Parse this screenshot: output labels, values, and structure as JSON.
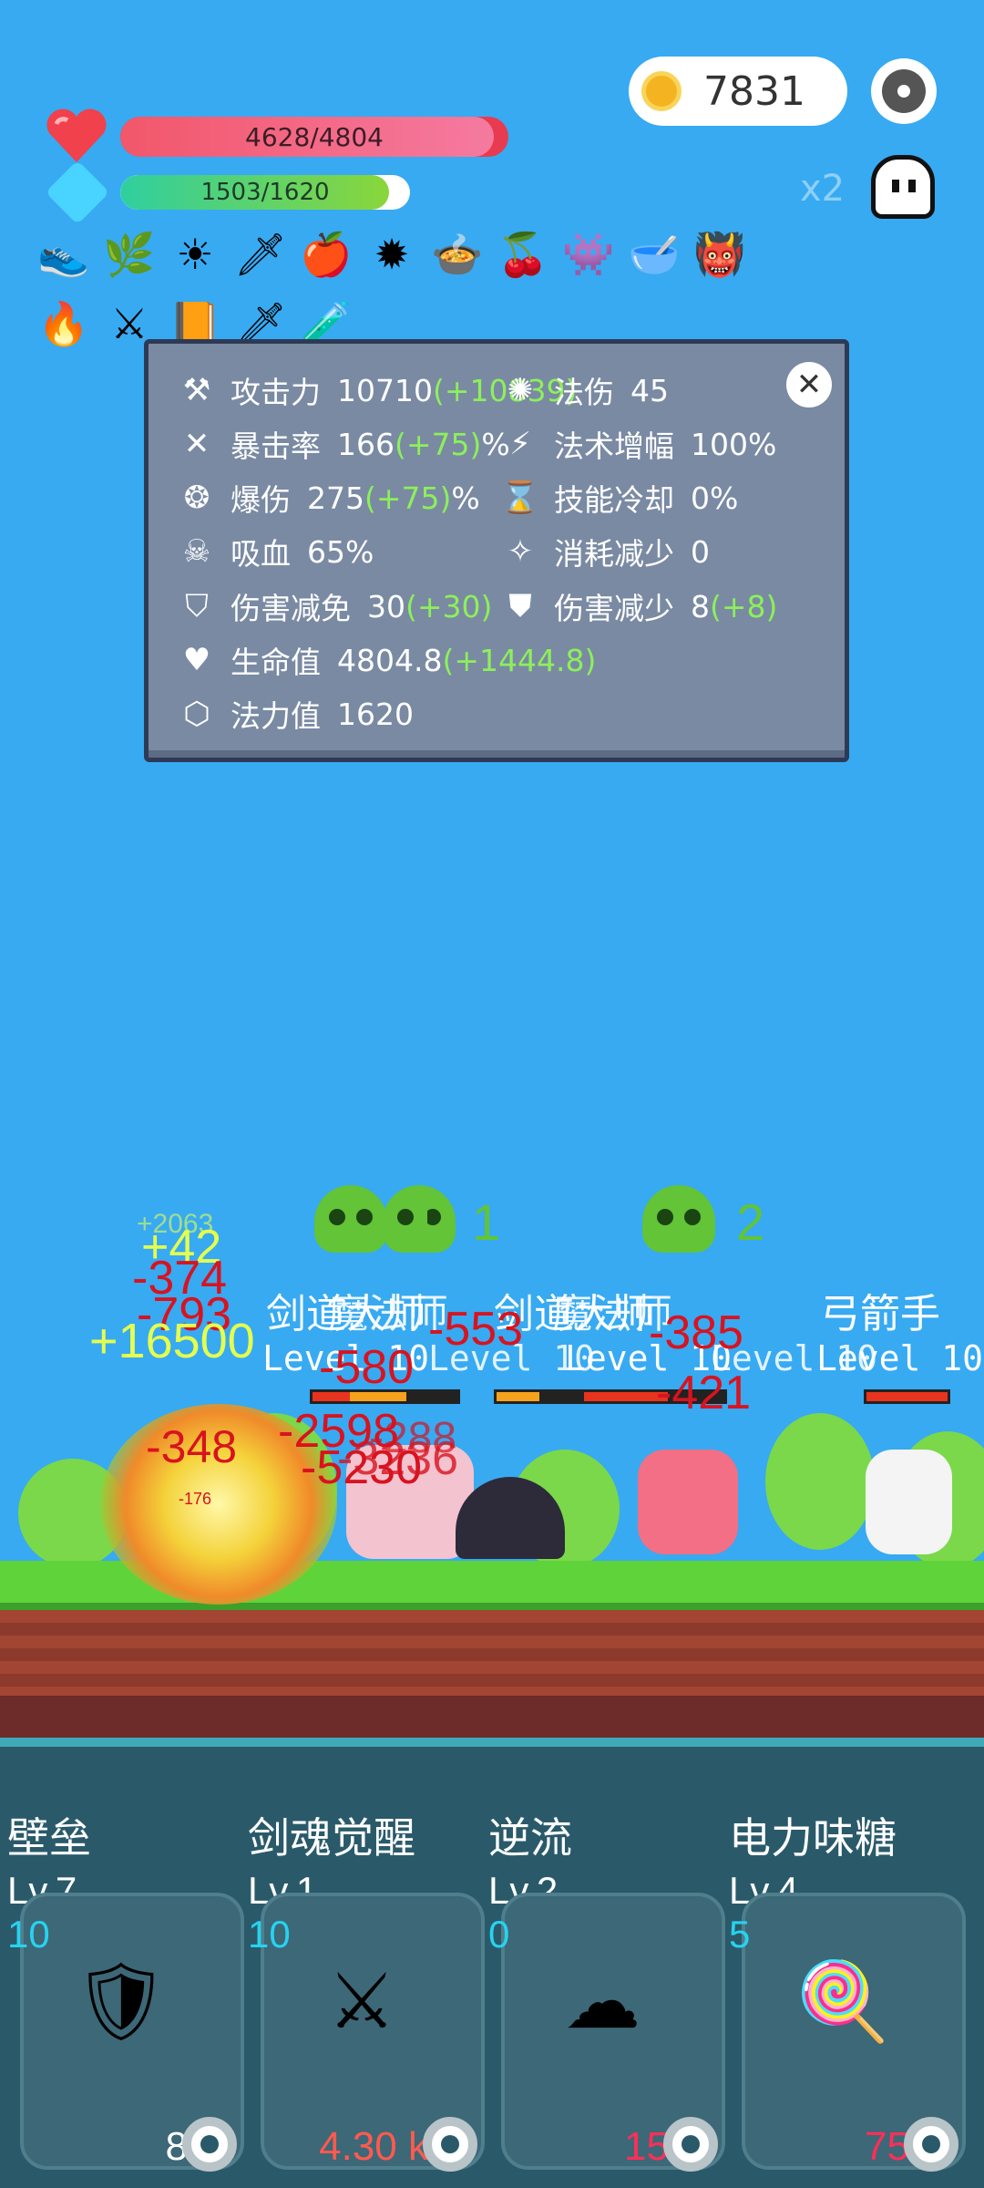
{
  "hud": {
    "coins": "7831",
    "hp_text": "4628/4804",
    "hp_fraction": 0.963,
    "mp_text": "1503/1620",
    "mp_fraction": 0.928,
    "speed": "x2"
  },
  "items": {
    "row1": [
      "👟",
      "🌿",
      "☀",
      "🗡",
      "🍎",
      "✹",
      "🍲",
      "🍒",
      "👾",
      "🥣",
      "👹"
    ],
    "row2": [
      "🔥",
      "⚔",
      "📙",
      "🗡",
      "🧪"
    ]
  },
  "stats": {
    "left": [
      {
        "icon": "axe-icon",
        "glyph": "⚒",
        "label": "攻击力",
        "value": "10710",
        "bonus": "(+10839)"
      },
      {
        "icon": "crit-icon",
        "glyph": "✕",
        "label": "暴击率",
        "value": "166",
        "bonus": "(+75)",
        "unit": "%"
      },
      {
        "icon": "burst-icon",
        "glyph": "❂",
        "label": "爆伤",
        "value": "275",
        "bonus": "(+75)",
        "unit": "%"
      },
      {
        "icon": "vampire-icon",
        "glyph": "☠",
        "label": "吸血",
        "value": "65%",
        "bonus": ""
      },
      {
        "icon": "shield-icon",
        "glyph": "⛉",
        "label": "伤害减免",
        "value": "30",
        "bonus": "(+30)"
      },
      {
        "icon": "heart-icon",
        "glyph": "♥",
        "label": "生命值",
        "value": "4804.8",
        "bonus": "(+1444.8)"
      },
      {
        "icon": "mana-icon",
        "glyph": "⬡",
        "label": "法力值",
        "value": "1620",
        "bonus": ""
      }
    ],
    "right": [
      {
        "icon": "spell-damage-icon",
        "glyph": "✺",
        "label": "法伤",
        "value": "45",
        "bonus": ""
      },
      {
        "icon": "lightning-icon",
        "glyph": "⚡",
        "label": "法术增幅",
        "value": "100%",
        "bonus": ""
      },
      {
        "icon": "hourglass-icon",
        "glyph": "⌛",
        "label": "技能冷却",
        "value": "0%",
        "bonus": ""
      },
      {
        "icon": "wand-icon",
        "glyph": "✧",
        "label": "消耗减少",
        "value": "0",
        "bonus": ""
      },
      {
        "icon": "armor-icon",
        "glyph": "⛊",
        "label": "伤害减少",
        "value": "8",
        "bonus": "(+8)"
      }
    ]
  },
  "battle": {
    "kills": [
      "1",
      "1",
      "2"
    ],
    "enemy_names": [
      "剑道大师",
      "魔法师",
      "剑道大师",
      "魔法师",
      "弓箭手"
    ],
    "enemy_level_text": "Level 10",
    "damage_numbers": [
      "-374",
      "-793",
      "-553",
      "-385",
      "-580",
      "-421",
      "-5230",
      "-348",
      "-2598",
      "-3236",
      "-288"
    ],
    "heal_numbers": [
      "+42",
      "+16500",
      "+2063"
    ],
    "small_text": "-176"
  },
  "skills": [
    {
      "name": "壁垒",
      "level": "Lv.7",
      "num": "10",
      "icon": "armor-skill-icon",
      "glyph": "🛡",
      "cost": "8",
      "cost_color": "#ffffff"
    },
    {
      "name": "剑魂觉醒",
      "level": "Lv.1",
      "num": "10",
      "icon": "crossed-swords-icon",
      "glyph": "⚔",
      "cost": "4.30 k",
      "cost_color": "#ff5a4e"
    },
    {
      "name": "逆流",
      "level": "Lv.2",
      "num": "0",
      "icon": "wave-icon",
      "glyph": "☁",
      "cost": "15",
      "cost_color": "#ff2f57"
    },
    {
      "name": "电力味糖",
      "level": "Lv.4",
      "num": "5",
      "icon": "lollipop-icon",
      "glyph": "🍭",
      "cost": "75",
      "cost_color": "#ff2f57"
    }
  ]
}
